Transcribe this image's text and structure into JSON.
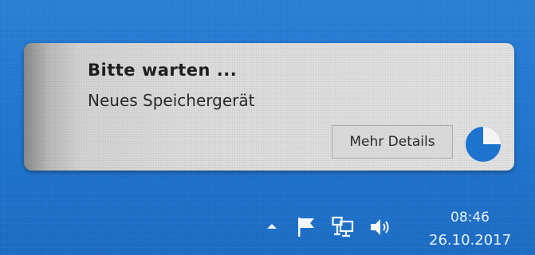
{
  "notification": {
    "title": "Bitte warten ...",
    "message": "Neues Speichergerät",
    "details_button": "Mehr Details",
    "progress_icon": "progress-pie-icon",
    "progress_fraction": 0.25,
    "accent_color": "#1e73cf"
  },
  "taskbar": {
    "tray_icons": [
      "show-hidden-icons-chevron-icon",
      "flag-icon",
      "network-icon",
      "volume-icon"
    ],
    "clock_time": "08:46",
    "clock_date": "26.10.2017",
    "background_color": "#1f74cf"
  }
}
